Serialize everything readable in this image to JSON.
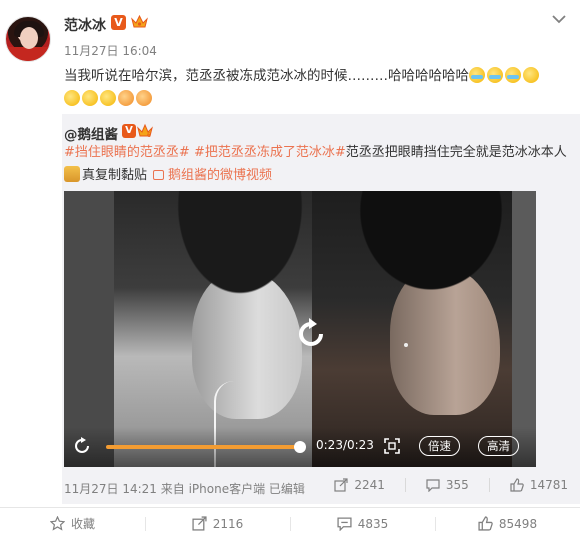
{
  "post": {
    "username": "范冰冰",
    "verified_badge": "V",
    "timestamp": "11月27日 16:04",
    "text": "当我听说在哈尔滨，范丞丞被冻成范冰冰的时候………哈哈哈哈哈哈",
    "trailing_emojis": [
      "laugh-cry-emoji",
      "laugh-cry-emoji",
      "laugh-cry-emoji",
      "smile-emoji"
    ],
    "second_line_emojis": [
      "smile-emoji",
      "smile-emoji",
      "smile-emoji",
      "drool-emoji",
      "drool-emoji"
    ]
  },
  "repost": {
    "username": "@鹅组酱",
    "verified_badge": "V",
    "hashtag1": "#挡住眼睛的范丞丞#",
    "hashtag2": "#把范丞丞冻成了范冰冰#",
    "text_rest": "范丞丞把眼睛挡住完全就是范冰冰本人",
    "text_tail": "真复制黏贴",
    "video_link": "鹅组酱的微博视频",
    "video": {
      "time": "0:23/0:23",
      "progress": 1.0,
      "speed_label": "倍速",
      "quality_label": "高清"
    },
    "meta": "11月27日 14:21 来自 iPhone客户端  已编辑",
    "stats": {
      "reposts": "2241",
      "comments": "355",
      "likes": "14781"
    }
  },
  "actions": {
    "favorite": "收藏",
    "repost": "2116",
    "comment": "4835",
    "like": "85498"
  },
  "colors": {
    "accent": "#eb7350",
    "badge": "#e8591a",
    "progress": "#f39c32"
  }
}
